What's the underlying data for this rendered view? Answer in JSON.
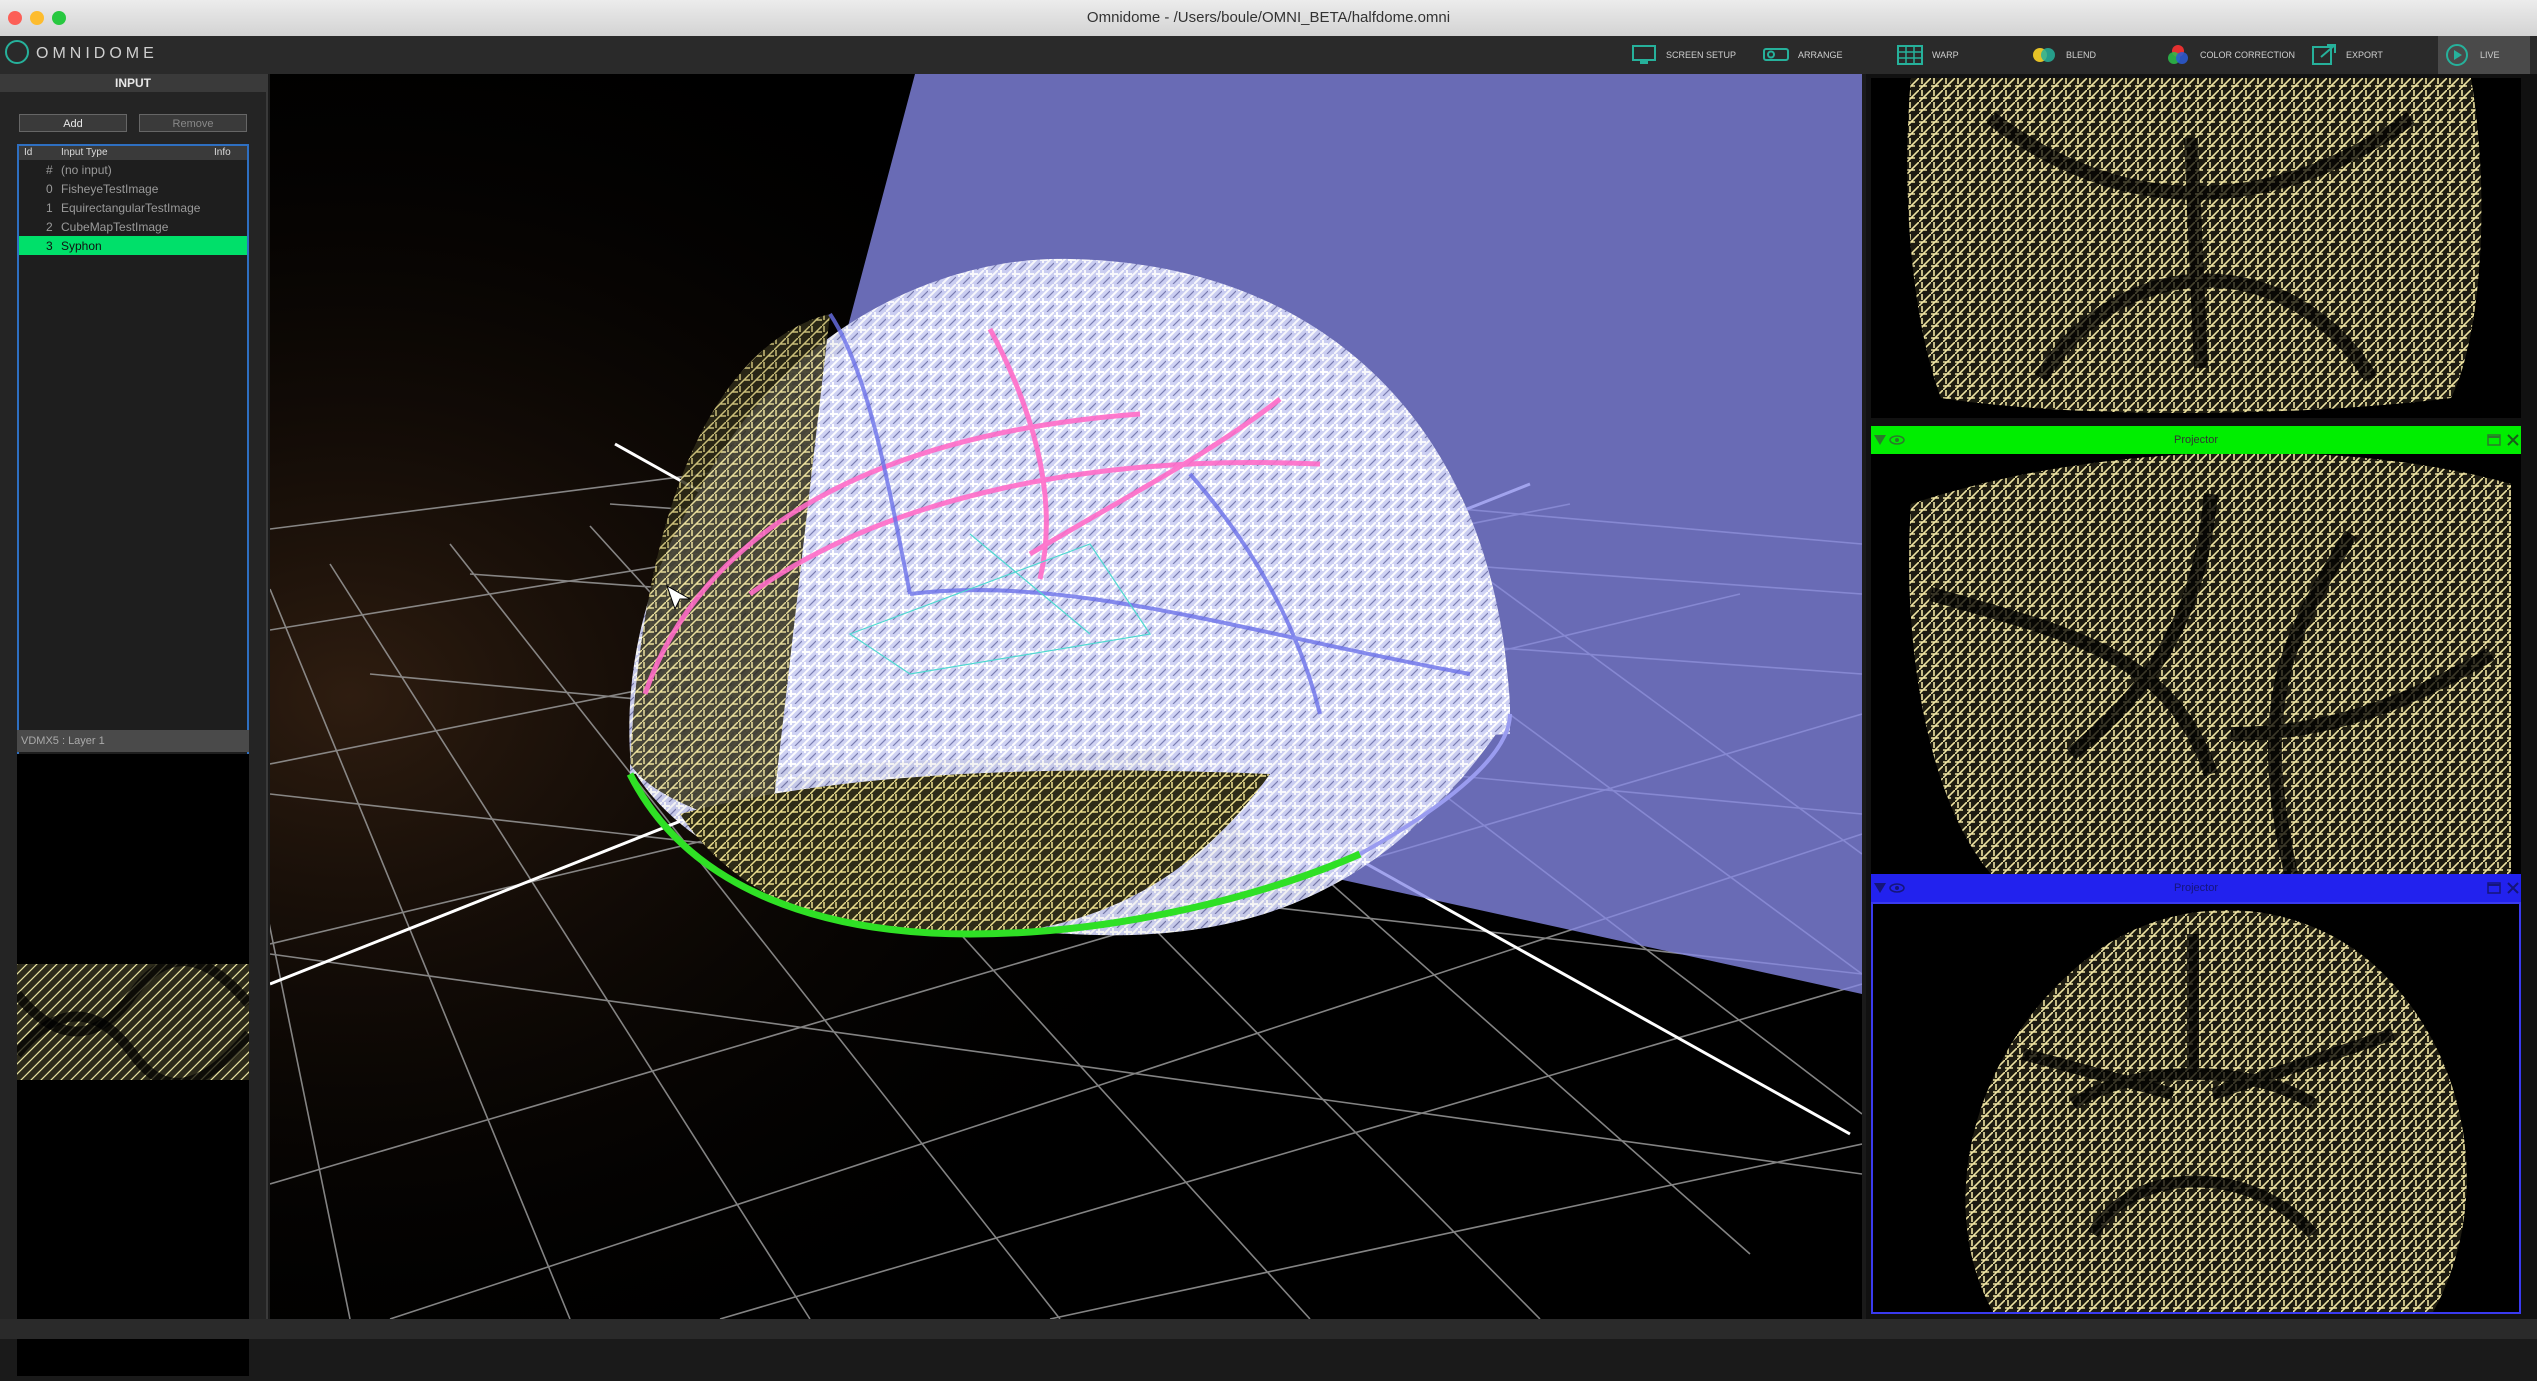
{
  "window": {
    "title": "Omnidome - /Users/boule/OMNI_BETA/halfdome.omni"
  },
  "app": {
    "logo_text": "OMNIDOME"
  },
  "toolbar": {
    "items": [
      {
        "label": "SCREEN SETUP",
        "icon": "monitor-icon"
      },
      {
        "label": "ARRANGE",
        "icon": "projector-icon"
      },
      {
        "label": "WARP",
        "icon": "grid-icon"
      },
      {
        "label": "BLEND",
        "icon": "blend-circles-icon"
      },
      {
        "label": "COLOR CORRECTION",
        "icon": "rgb-drop-icon"
      },
      {
        "label": "EXPORT",
        "icon": "export-icon"
      },
      {
        "label": "LIVE",
        "icon": "play-icon"
      }
    ]
  },
  "input_panel": {
    "title": "INPUT",
    "add_label": "Add",
    "remove_label": "Remove",
    "columns": [
      "Id",
      "Input Type",
      "Info"
    ],
    "rows": [
      {
        "id": "#",
        "type": "(no input)"
      },
      {
        "id": "0",
        "type": "FisheyeTestImage"
      },
      {
        "id": "1",
        "type": "EquirectangularTestImage"
      },
      {
        "id": "2",
        "type": "CubeMapTestImage"
      },
      {
        "id": "3",
        "type": "Syphon"
      }
    ],
    "selected_row": 4,
    "preview_title": "VDMX5 : Layer 1"
  },
  "projectors": {
    "views": [
      {
        "label": "Projector",
        "bar_color": "#00ee00"
      },
      {
        "label": "Projector",
        "bar_color": "#2222ee"
      }
    ]
  },
  "colors": {
    "selection": "#00e06a",
    "list_border": "#2e6fc1",
    "logo": "#26b19b"
  }
}
